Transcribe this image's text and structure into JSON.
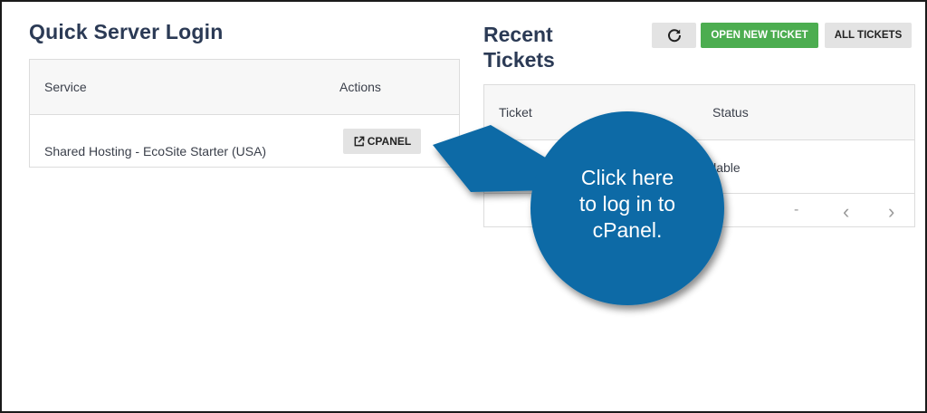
{
  "quick_server_login": {
    "title": "Quick Server Login",
    "headers": {
      "service": "Service",
      "actions": "Actions"
    },
    "row": {
      "service": "Shared Hosting - EcoSite Starter (USA)",
      "action_label": "CPANEL",
      "action_icon": "external-link-icon"
    }
  },
  "recent_tickets": {
    "title": "Recent Tickets",
    "toolbar": {
      "refresh_icon": "refresh-icon",
      "open_new_ticket": "OPEN NEW TICKET",
      "all_tickets": "ALL TICKETS"
    },
    "headers": {
      "ticket": "Ticket",
      "status": "Status"
    },
    "row_partial_text": "ilable",
    "pagination": {
      "range": "-",
      "prev": "‹",
      "next": "›"
    }
  },
  "callout": {
    "lines": [
      "Click here",
      "to log in to",
      "cPanel."
    ],
    "color": "#0b6aa6"
  },
  "colors": {
    "title": "#2b3a55",
    "green": "#4cad50",
    "button_gray": "#e3e3e3"
  }
}
